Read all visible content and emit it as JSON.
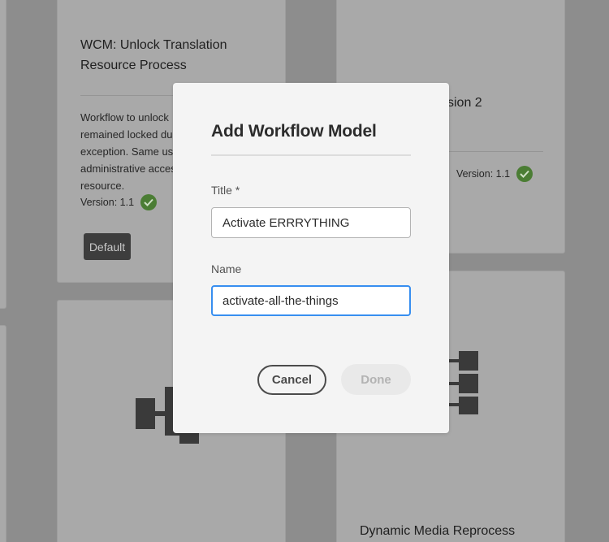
{
  "cards": {
    "unlock_translation": {
      "title_line1": "WCM: Unlock Translation",
      "title_line2": "Resource Process",
      "desc_lines": [
        "Workflow to unlock",
        "remained locked du",
        "exception. Same use",
        "administrative acces",
        "resource."
      ],
      "version": "Version: 1.1",
      "default_label": "Default"
    },
    "top_right": {
      "title_fragment": "sion 2",
      "version": "Version: 1.1"
    },
    "bottom_right": {
      "title": "Dynamic Media Reprocess"
    }
  },
  "dialog": {
    "title": "Add Workflow Model",
    "title_field": {
      "label": "Title *",
      "value": "Activate ERRRYTHING"
    },
    "name_field": {
      "label": "Name",
      "value": "activate-all-the-things"
    },
    "cancel_label": "Cancel",
    "done_label": "Done"
  },
  "colors": {
    "overlay": "#8d8d8d",
    "card": "#a9a9a9",
    "dialog": "#f4f4f4",
    "focus": "#378ef0",
    "success": "#4b7d34"
  }
}
